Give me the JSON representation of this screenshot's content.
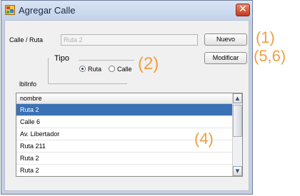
{
  "window": {
    "title": "Agregar Calle",
    "close_glyph": "✕"
  },
  "form": {
    "calle_label": "Calle / Ruta",
    "calle_value": "Ruta 2",
    "nuevo_label": "Nuevo",
    "modificar_label": "Modificar",
    "tipo_label": "Tipo",
    "radio_ruta_label": "Ruta",
    "radio_calle_label": "Calle",
    "selected_tipo": "Ruta",
    "info_label": "lblInfo"
  },
  "list": {
    "header": "nombre",
    "rows": [
      "Ruta 2",
      "Calle 6",
      "Av. Libertador",
      "Ruta 211",
      "Ruta 2",
      "Ruta 2"
    ],
    "selected_index": 0,
    "scroll_up_glyph": "▲",
    "scroll_down_glyph": "▼"
  },
  "annotations": [
    "(1)",
    "(2)",
    "(4)",
    "(5,6)"
  ],
  "colors": {
    "selection": "#3a72b5",
    "annotation": "#f0a040",
    "titlebar": "#c9d8ee"
  },
  "icons": [
    "app-icon",
    "close-icon",
    "scroll-up-icon",
    "scroll-down-icon"
  ]
}
